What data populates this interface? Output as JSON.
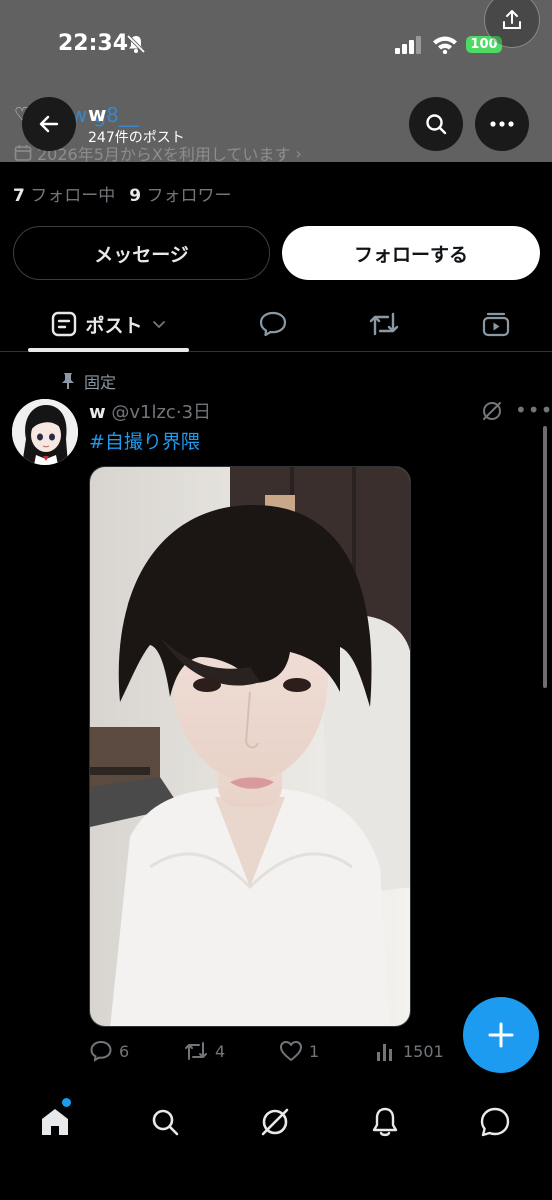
{
  "status_bar": {
    "time": "22:34",
    "battery": "100"
  },
  "header": {
    "ghost_name": "gw g8__",
    "title": "w",
    "post_count": "247件のポスト",
    "joined": "2026年5月からXを利用しています"
  },
  "profile": {
    "following_count": "7",
    "following_label": "フォロー中",
    "followers_count": "9",
    "followers_label": "フォロワー"
  },
  "buttons": {
    "message": "メッセージ",
    "follow": "フォローする"
  },
  "tabs": {
    "posts": "ポスト"
  },
  "post": {
    "pinned_label": "固定",
    "name": "w",
    "handle": "@v1lzc",
    "time": "3日",
    "hashtag": "#自撮り界隈",
    "replies": "6",
    "reposts": "4",
    "likes": "1",
    "views": "1501"
  },
  "colors": {
    "accent": "#1d9bf0",
    "header_bg": "#616161",
    "battery": "#4cd964"
  }
}
